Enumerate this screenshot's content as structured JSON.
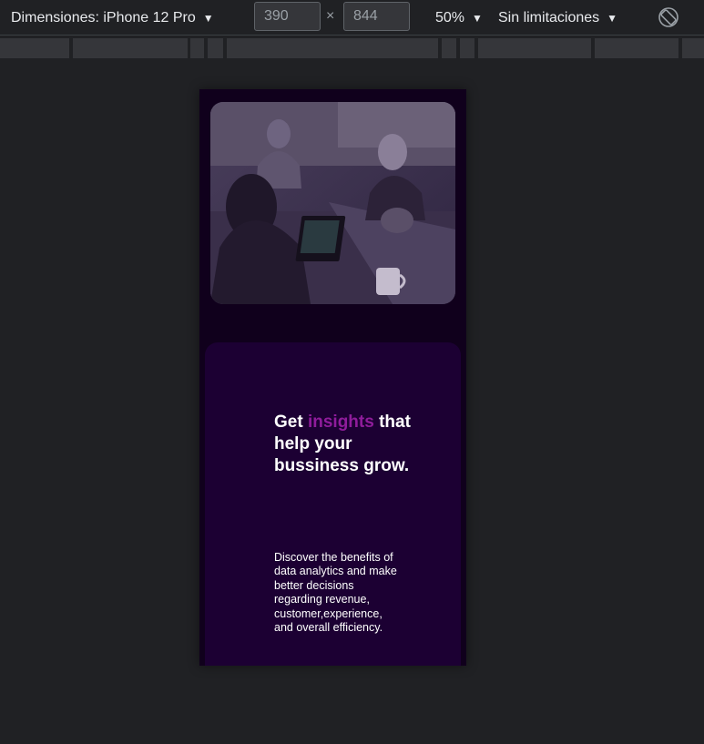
{
  "toolbar": {
    "dimensions_label": "Dimensiones: iPhone 12 Pro",
    "width_value": "390",
    "height_value": "844",
    "times_symbol": "×",
    "zoom_label": "50%",
    "throttle_label": "Sin limitaciones",
    "caret": "▼"
  },
  "page": {
    "headline_prefix": "Get",
    "headline_accent": "insights",
    "headline_rest": "that help your bussiness grow.",
    "description": "Discover the benefits of data analytics and make better decisions regarding revenue, customer,experience, and overall efficiency."
  },
  "colors": {
    "accent": "#8f1c9b",
    "card_bg": "#1c0033",
    "page_bg": "#10001c"
  },
  "icons": {
    "rotate": "rotate-icon",
    "caret": "chevron-down-icon"
  }
}
